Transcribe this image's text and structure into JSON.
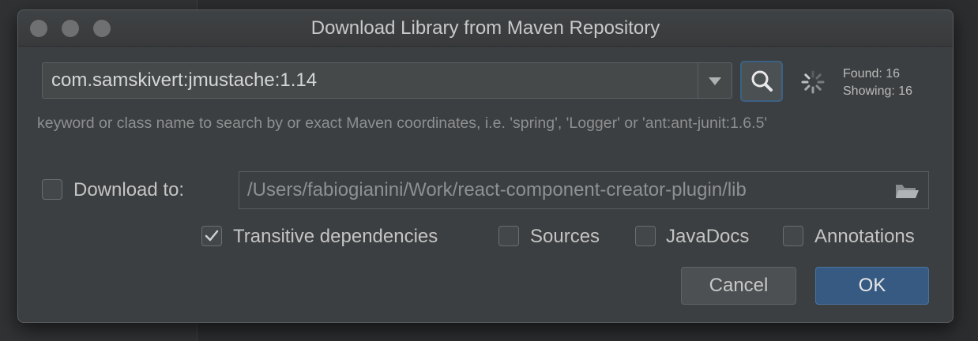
{
  "window": {
    "title": "Download Library from Maven Repository"
  },
  "search": {
    "value": "com.samskivert:jmustache:1.14",
    "hint": "keyword or class name to search by or exact Maven coordinates, i.e. 'spring', 'Logger' or 'ant:ant-junit:1.6.5'"
  },
  "results": {
    "found": "Found: 16",
    "showing": "Showing: 16"
  },
  "download_to": {
    "label": "Download to:",
    "checked": false,
    "path": "/Users/fabiogianini/Work/react-component-creator-plugin/lib"
  },
  "options": [
    {
      "label": "Transitive dependencies",
      "checked": true
    },
    {
      "label": "Sources",
      "checked": false
    },
    {
      "label": "JavaDocs",
      "checked": false
    },
    {
      "label": "Annotations",
      "checked": false
    }
  ],
  "buttons": {
    "cancel": "Cancel",
    "ok": "OK"
  },
  "icons": {
    "search": "search-icon",
    "spinner": "loading-spinner-icon",
    "folder": "folder-open-icon",
    "dropdown": "chevron-down-icon",
    "check": "checkmark-icon"
  },
  "colors": {
    "accent": "#375a83",
    "focus_border": "#3d6185",
    "dialog_bg": "#3c3f41"
  }
}
